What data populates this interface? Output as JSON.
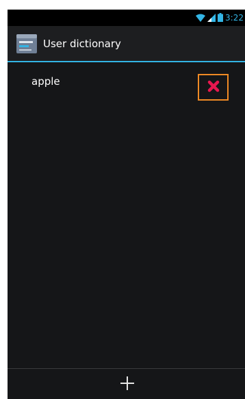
{
  "status_bar": {
    "time": "3:22",
    "icons": [
      "wifi-icon",
      "signal-icon",
      "battery-icon"
    ],
    "accent_color": "#33b5e5"
  },
  "action_bar": {
    "title": "User dictionary",
    "icon": "dictionary-app-icon"
  },
  "words": [
    {
      "word": "apple",
      "delete_icon": "delete-x-icon",
      "delete_color": "#e8174f"
    }
  ],
  "bottom_bar": {
    "add_icon": "plus-icon"
  },
  "colors": {
    "background": "#151618",
    "divider": "#33b5e5",
    "highlight_border": "#f08a24"
  }
}
